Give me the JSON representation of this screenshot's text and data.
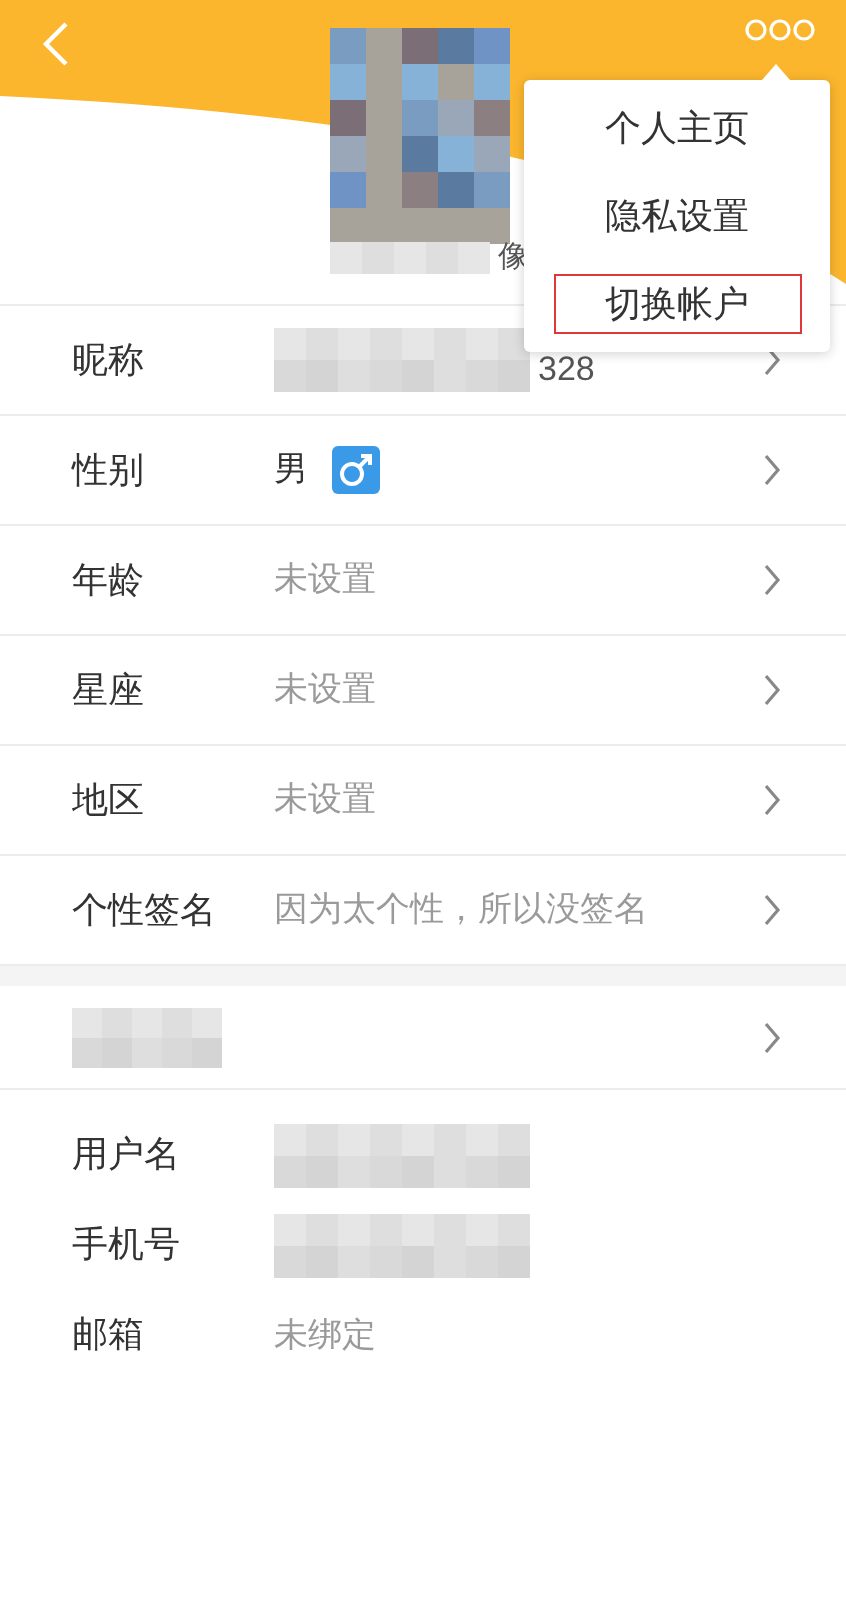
{
  "header": {
    "avatar_caption": "像"
  },
  "menu": {
    "items": [
      {
        "label": "个人主页",
        "selected": false
      },
      {
        "label": "隐私设置",
        "selected": false
      },
      {
        "label": "切换帐户",
        "selected": true
      }
    ]
  },
  "profile_rows": [
    {
      "label": "昵称",
      "kind": "redacted",
      "value": "328",
      "chevron": true
    },
    {
      "label": "性别",
      "kind": "gender",
      "value": "男",
      "chevron": true
    },
    {
      "label": "年龄",
      "kind": "text",
      "value": "未设置",
      "chevron": true
    },
    {
      "label": "星座",
      "kind": "text",
      "value": "未设置",
      "chevron": true
    },
    {
      "label": "地区",
      "kind": "text",
      "value": "未设置",
      "chevron": true
    },
    {
      "label": "个性签名",
      "kind": "text",
      "value": "因为太个性，所以没签名",
      "chevron": true
    }
  ],
  "account_rows": [
    {
      "kind": "redacted_label",
      "chevron": true
    },
    {
      "label": "用户名",
      "kind": "redacted",
      "chevron": false
    },
    {
      "label": "手机号",
      "kind": "redacted",
      "chevron": false
    },
    {
      "label": "邮箱",
      "kind": "text",
      "value": "未绑定",
      "chevron": false
    }
  ]
}
